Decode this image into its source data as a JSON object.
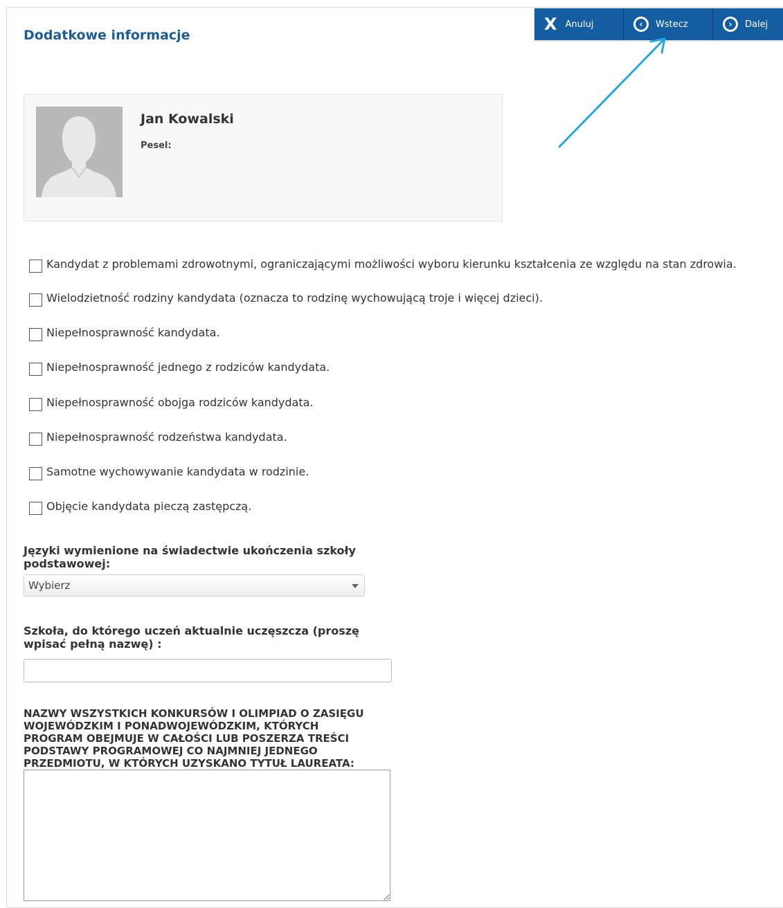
{
  "page": {
    "title": "Dodatkowe informacje"
  },
  "toolbar": {
    "cancel_label": "Anuluj",
    "back_label": "Wstecz",
    "next_label": "Dalej",
    "bg_color": "#145da0"
  },
  "candidate": {
    "name": "Jan Kowalski",
    "pesel_label": "Pesel:"
  },
  "checkboxes": [
    {
      "label": "Kandydat z problemami zdrowotnymi, ograniczającymi możliwości wyboru kierunku kształcenia ze względu na stan zdrowia.",
      "checked": false
    },
    {
      "label": "Wielodzietność rodziny kandydata (oznacza to rodzinę wychowującą troje i więcej dzieci).",
      "checked": false
    },
    {
      "label": "Niepełnosprawność kandydata.",
      "checked": false
    },
    {
      "label": "Niepełnosprawność jednego z rodziców kandydata.",
      "checked": false
    },
    {
      "label": "Niepełnosprawność obojga rodziców kandydata.",
      "checked": false
    },
    {
      "label": "Niepełnosprawność rodzeństwa kandydata.",
      "checked": false
    },
    {
      "label": "Samotne wychowywanie kandydata w rodzinie.",
      "checked": false
    },
    {
      "label": "Objęcie kandydata pieczą zastępczą.",
      "checked": false
    }
  ],
  "languages": {
    "label": "Języki wymienione na świadectwie ukończenia szkoły podstawowej:",
    "selected": "Wybierz"
  },
  "school": {
    "label": "Szkoła, do którego uczeń aktualnie uczęszcza (proszę wpisać pełną nazwę) :",
    "value": ""
  },
  "contests": {
    "label": "NAZWY WSZYSTKICH KONKURSÓW I OLIMPIAD O ZASIĘGU WOJEWÓDZKIM I PONADWOJEWÓDZKIM, KTÓRYCH PROGRAM OBEJMUJE W CAŁOŚCI LUB POSZERZA TREŚCI PODSTAWY PROGRAMOWEJ CO NAJMNIEJ JEDNEGO PRZEDMIOTU, W KTÓRYCH UZYSKANO TYTUŁ LAUREATA:",
    "value": ""
  },
  "annotation": {
    "arrow_color": "#22a7e0"
  }
}
